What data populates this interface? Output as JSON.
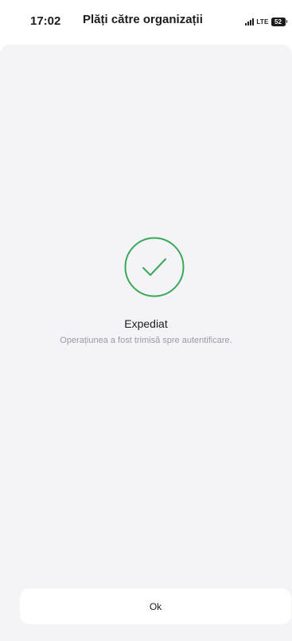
{
  "status_bar": {
    "time": "17:02",
    "network": "LTE",
    "battery": "52",
    "signal_icon": "signal-bars-icon",
    "battery_icon": "battery-icon"
  },
  "header": {
    "title": "Plăți către organizații"
  },
  "result": {
    "icon": "checkmark-circle-icon",
    "icon_color": "#3aa757",
    "title": "Expediat",
    "message": "Operațiunea a fost trimisă spre autentificare."
  },
  "actions": {
    "ok_label": "Ok"
  }
}
